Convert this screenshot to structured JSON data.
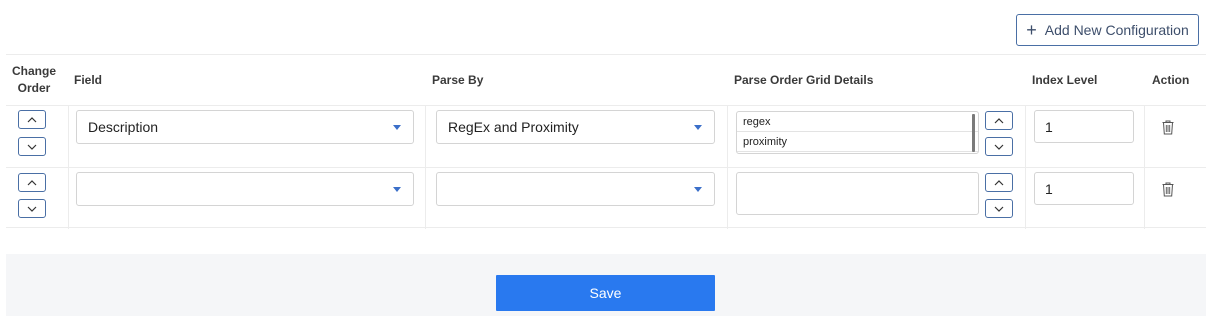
{
  "toolbar": {
    "add_label": "Add New Configuration"
  },
  "table": {
    "headers": {
      "change_order": "Change Order",
      "field": "Field",
      "parse_by": "Parse By",
      "grid_details": "Parse Order Grid Details",
      "index_level": "Index Level",
      "action": "Action"
    },
    "rows": [
      {
        "field": "Description",
        "parse_by": "RegEx and Proximity",
        "grid_items": [
          "regex",
          "proximity"
        ],
        "index_level": "1"
      },
      {
        "field": "",
        "parse_by": "",
        "grid_items": [],
        "index_level": "1"
      }
    ]
  },
  "footer": {
    "save_label": "Save"
  },
  "icons": [
    "plus-icon",
    "chevron-up-icon",
    "chevron-down-icon",
    "caret-down-icon",
    "trash-icon"
  ],
  "colors": {
    "accent": "#2979ef",
    "outline": "#4a6fa5",
    "caret": "#3b6fc9",
    "footer_bg": "#f5f6f8"
  }
}
